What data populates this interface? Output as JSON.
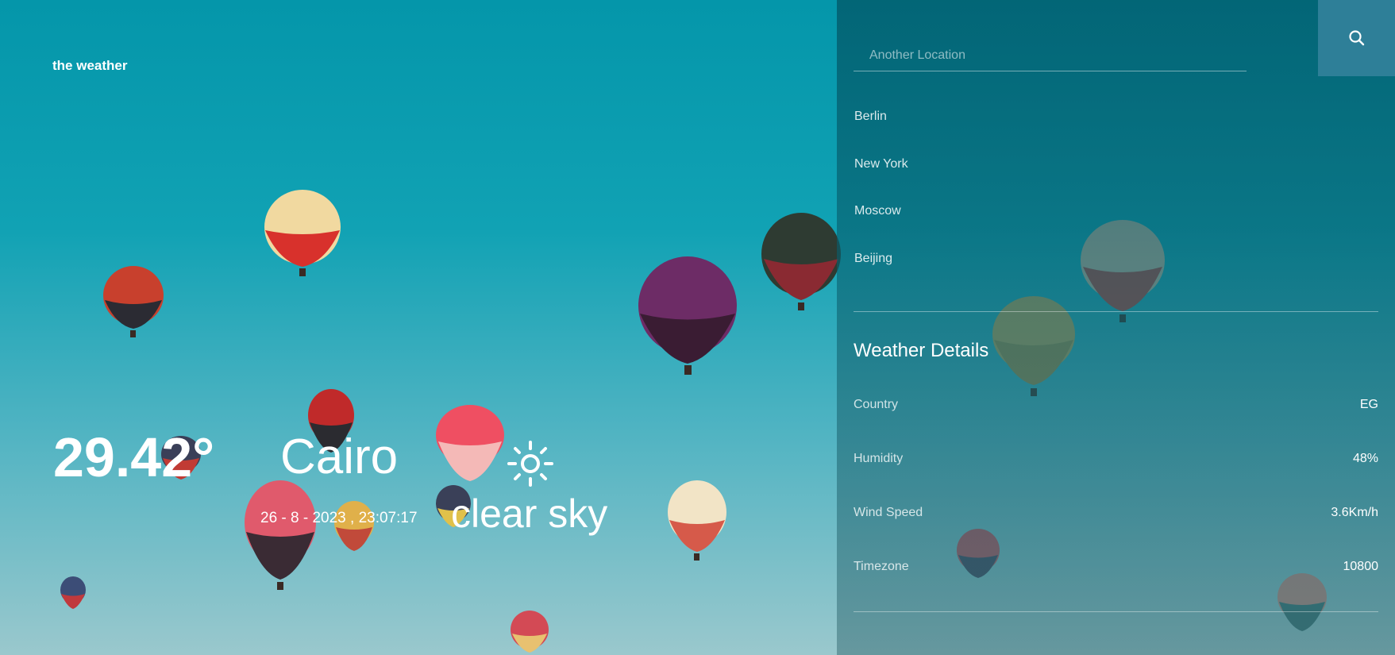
{
  "brand": "the weather",
  "current": {
    "temperature": "29.42°",
    "city": "Cairo",
    "datetime": "26 - 8 - 2023 , 23:07:17",
    "description": "clear sky",
    "icon": "sun-icon"
  },
  "search": {
    "placeholder": "Another Location",
    "value": "",
    "button_icon": "search-icon"
  },
  "locations": [
    "Berlin",
    "New York",
    "Moscow",
    "Beijing"
  ],
  "details": {
    "title": "Weather Details",
    "rows": [
      {
        "label": "Country",
        "value": "EG"
      },
      {
        "label": "Humidity",
        "value": "48%"
      },
      {
        "label": "Wind Speed",
        "value": "3.6Km/h"
      },
      {
        "label": "Timezone",
        "value": "10800"
      }
    ]
  },
  "colors": {
    "panel": "#0a6474",
    "search_button": "#2e7f98",
    "sky_top": "#0496aa",
    "sky_bottom": "#9ac8cd"
  }
}
